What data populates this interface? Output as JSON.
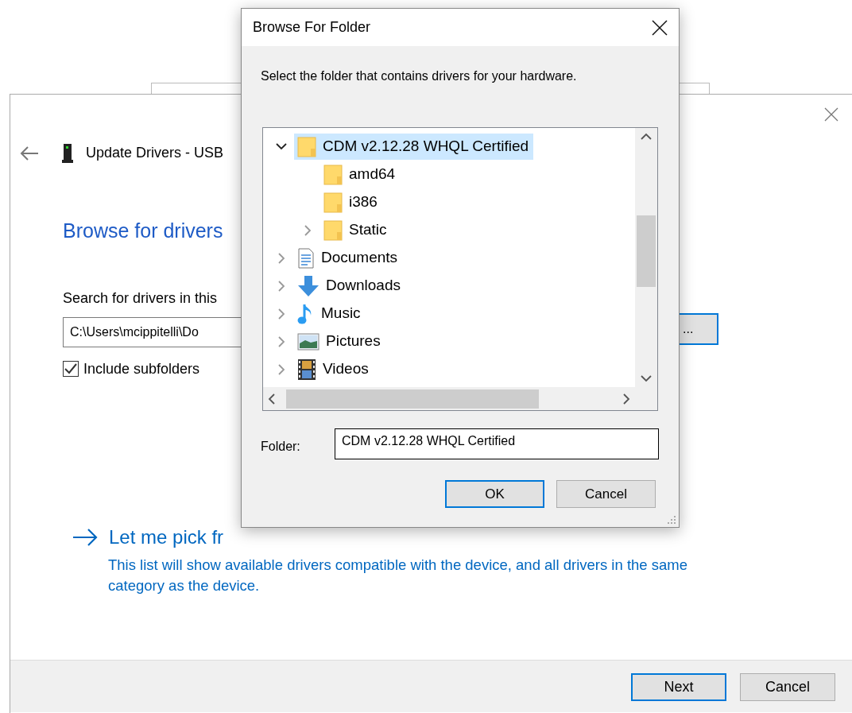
{
  "wizard": {
    "header_title": "Update Drivers - USB",
    "heading": "Browse for drivers",
    "search_label": "Search for drivers in this",
    "path_value": "C:\\Users\\mcippitelli\\Do",
    "browse_button": "...",
    "include_subfolders": {
      "label": "Include subfolders",
      "checked": true
    },
    "pick_link": "Let me pick fr",
    "pick_description": "This list will show available drivers compatible with the device, and all drivers in the same category as the device.",
    "buttons": [
      {
        "label": "Next",
        "default": true
      },
      {
        "label": "Cancel",
        "default": false
      }
    ]
  },
  "dialog": {
    "title": "Browse For Folder",
    "instruction": "Select the folder that contains drivers for your hardware.",
    "tree": [
      {
        "label": "CDM v2.12.28 WHQL Certified",
        "kind": "folder",
        "expandable": true,
        "expanded": true,
        "selected": true,
        "children": [
          {
            "label": "amd64",
            "kind": "folder",
            "expandable": false,
            "selected": false
          },
          {
            "label": "i386",
            "kind": "folder",
            "expandable": false,
            "selected": false
          },
          {
            "label": "Static",
            "kind": "folder",
            "expandable": true,
            "expanded": false,
            "selected": false
          }
        ]
      },
      {
        "label": "Documents",
        "kind": "documents",
        "expandable": true,
        "expanded": false,
        "selected": false
      },
      {
        "label": "Downloads",
        "kind": "downloads",
        "expandable": true,
        "expanded": false,
        "selected": false
      },
      {
        "label": "Music",
        "kind": "music",
        "expandable": true,
        "expanded": false,
        "selected": false
      },
      {
        "label": "Pictures",
        "kind": "pictures",
        "expandable": true,
        "expanded": false,
        "selected": false
      },
      {
        "label": "Videos",
        "kind": "videos",
        "expandable": true,
        "expanded": false,
        "selected": false
      }
    ],
    "folder_label": "Folder:",
    "folder_value": "CDM v2.12.28 WHQL Certified",
    "buttons": [
      {
        "label": "OK",
        "default": true
      },
      {
        "label": "Cancel",
        "default": false
      }
    ]
  }
}
